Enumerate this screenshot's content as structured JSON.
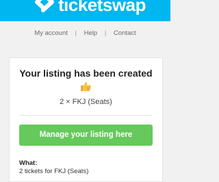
{
  "header": {
    "brand": "ticketswap",
    "logo_icon": "ticketswap-logo-icon",
    "background_color": "#00b6f0"
  },
  "nav": {
    "my_account": "My account",
    "help": "Help",
    "contact": "Contact",
    "separator": "|"
  },
  "card": {
    "title": "Your listing has been created",
    "title_emoji_icon": "thumbs-up-icon",
    "quantity_line": "2 × FKJ (Seats)",
    "manage_button": "Manage your listing here",
    "manage_button_color": "#66c95c",
    "what_label": "What:",
    "what_value": "2 tickets for FKJ (Seats)"
  }
}
